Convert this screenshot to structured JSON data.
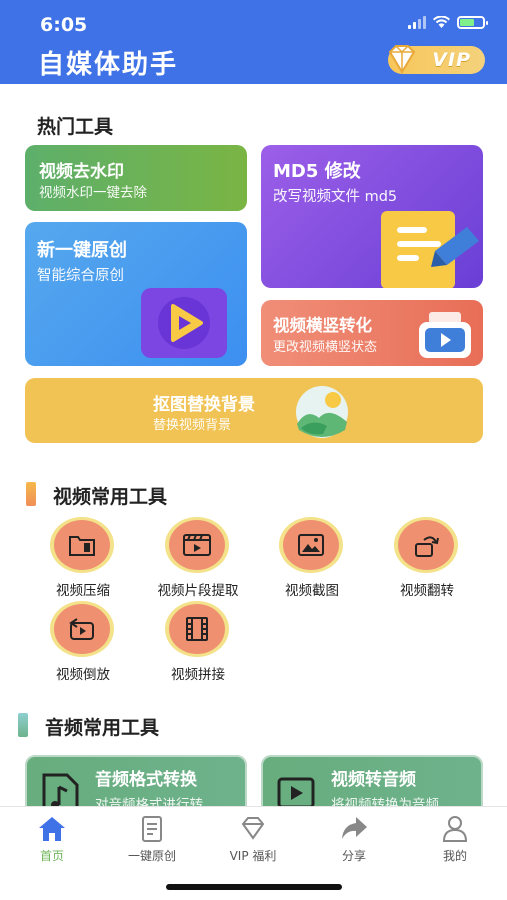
{
  "status_bar": {
    "time": "6:05"
  },
  "header": {
    "title": "自媒体助手",
    "vip_label": "VIP"
  },
  "hot_tools": {
    "title": "热门工具",
    "watermark": {
      "title": "视频去水印",
      "subtitle": "视频水印一键去除"
    },
    "md5": {
      "title": "MD5 修改",
      "subtitle": "改写视频文件 md5"
    },
    "original": {
      "title": "新一键原创",
      "subtitle": "智能综合原创"
    },
    "rotate": {
      "title": "视频横竖转化",
      "subtitle": "更改视频横竖状态"
    },
    "background": {
      "title": "抠图替换背景",
      "subtitle": "替换视频背景"
    }
  },
  "video_tools": {
    "title": "视频常用工具",
    "items": [
      {
        "label": "视频压缩",
        "icon": "compress-icon"
      },
      {
        "label": "视频片段提取",
        "icon": "clip-icon"
      },
      {
        "label": "视频截图",
        "icon": "screenshot-icon"
      },
      {
        "label": "视频翻转",
        "icon": "flip-icon"
      },
      {
        "label": "视频倒放",
        "icon": "reverse-icon"
      },
      {
        "label": "视频拼接",
        "icon": "film-icon"
      }
    ]
  },
  "audio_tools": {
    "title": "音频常用工具",
    "format": {
      "title": "音频格式转换",
      "subtitle": "对音频格式进行转"
    },
    "to_audio": {
      "title": "视频转音频",
      "subtitle": "将视频转换为音频"
    }
  },
  "tabbar": {
    "items": [
      {
        "label": "首页",
        "icon": "home-icon"
      },
      {
        "label": "一键原创",
        "icon": "document-icon"
      },
      {
        "label": "VIP 福利",
        "icon": "diamond-icon"
      },
      {
        "label": "分享",
        "icon": "share-icon"
      },
      {
        "label": "我的",
        "icon": "profile-icon"
      }
    ]
  },
  "colors": {
    "header": "#3f72e6",
    "active_tab": "#6fb55a",
    "tool_ring": "#f3e28a",
    "tool_fill": "#ef9170"
  }
}
